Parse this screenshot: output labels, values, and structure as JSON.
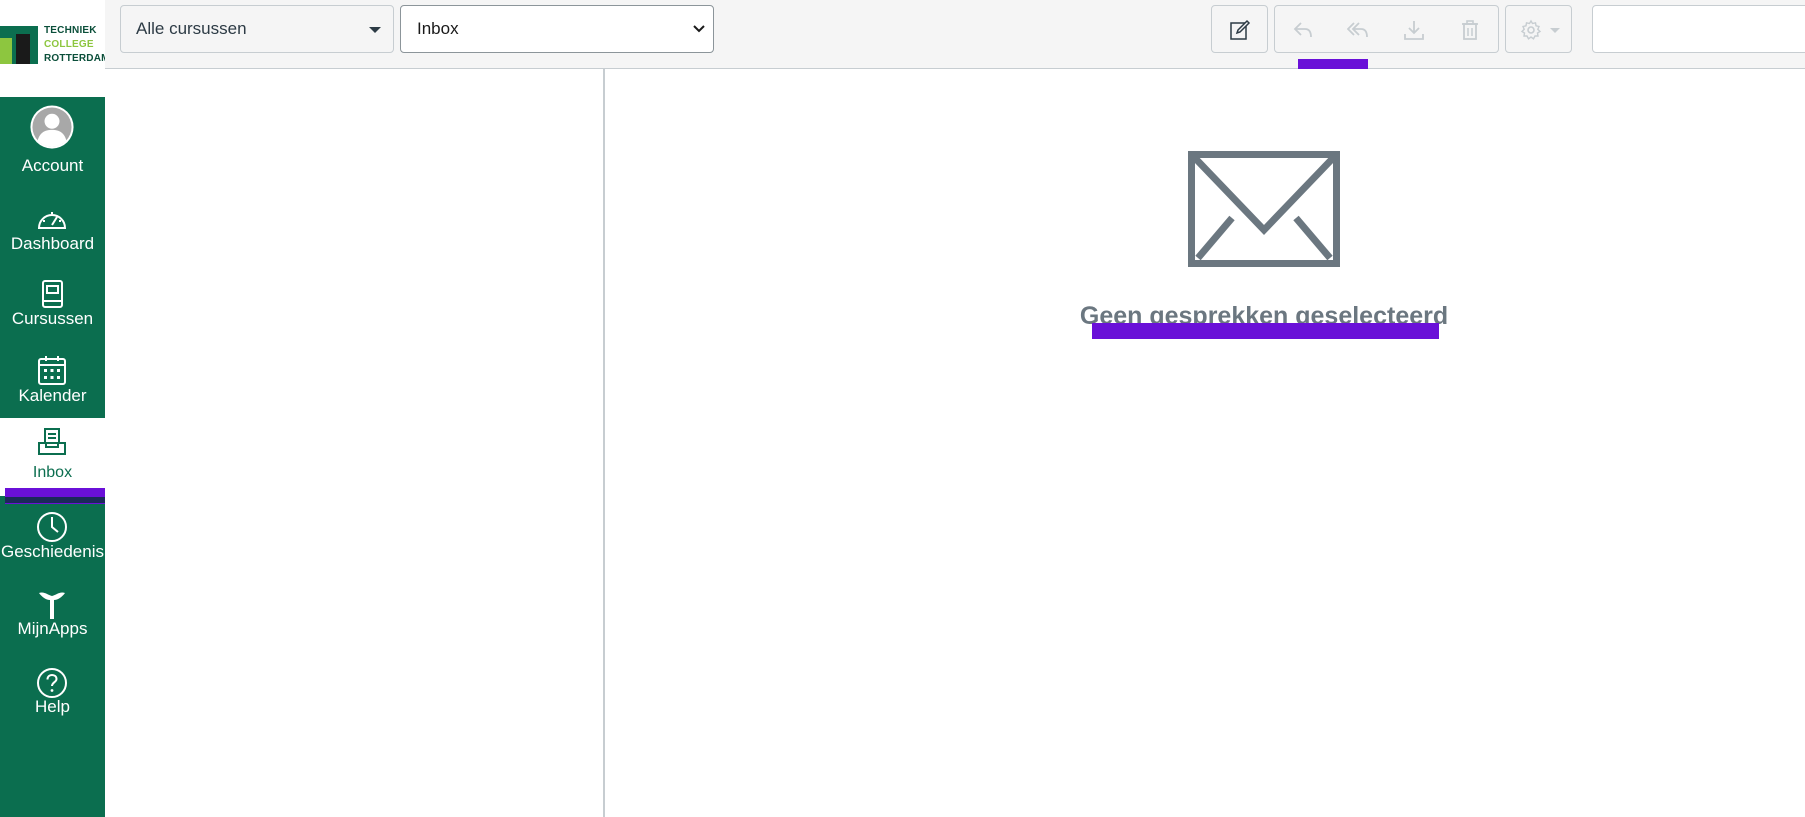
{
  "logo": {
    "line1": "TECHNIEK",
    "line2": "COLLEGE",
    "line3": "ROTTERDAM"
  },
  "colors": {
    "nav_bg": "#0b6e4f",
    "brand_lime": "#8dc63f",
    "marker": "#6a10d8",
    "muted_text": "#6b7780"
  },
  "nav": {
    "items": [
      {
        "label": "Account",
        "icon": "avatar-icon"
      },
      {
        "label": "Dashboard",
        "icon": "dashboard-icon"
      },
      {
        "label": "Cursussen",
        "icon": "courses-icon"
      },
      {
        "label": "Kalender",
        "icon": "calendar-icon"
      },
      {
        "label": "Inbox",
        "icon": "inbox-icon",
        "active": true
      },
      {
        "label": "Geschiedenis",
        "icon": "history-icon"
      },
      {
        "label": "MijnApps",
        "icon": "apps-icon"
      },
      {
        "label": "Help",
        "icon": "help-icon"
      }
    ]
  },
  "toolbar": {
    "course_filter": "Alle cursussen",
    "mailbox_filter": "Inbox",
    "buttons": [
      "compose-icon",
      "reply-icon",
      "reply-all-icon",
      "archive-icon",
      "delete-icon",
      "gear-icon"
    ],
    "search_value": ""
  },
  "message_pane": {
    "empty_title": "Geen gesprekken geselecteerd",
    "icon": "envelope-icon"
  }
}
